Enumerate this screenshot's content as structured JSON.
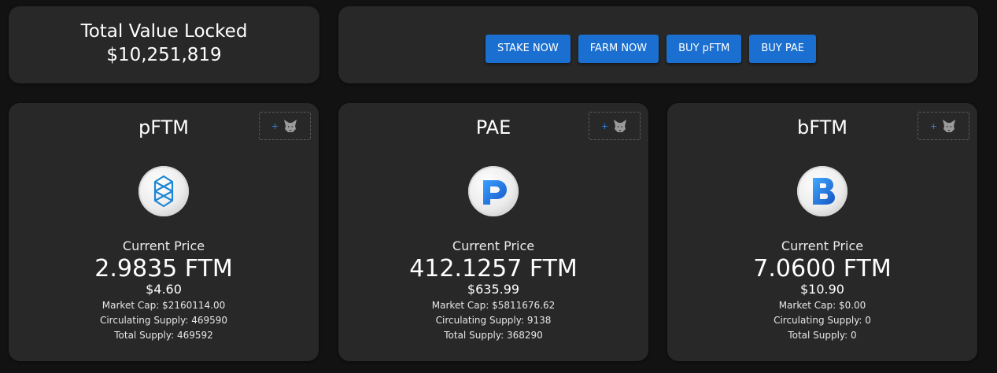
{
  "tvl": {
    "title": "Total Value Locked",
    "value": "$10,251,819"
  },
  "actions": {
    "stake_label": "STAKE NOW",
    "farm_label": "FARM NOW",
    "buy_pftm_label": "BUY pFTM",
    "buy_pae_label": "BUY PAE"
  },
  "tokens": [
    {
      "name": "pFTM",
      "icon": "fantom-icon",
      "price_label": "Current Price",
      "price_ftm": "2.9835 FTM",
      "price_usd": "$4.60",
      "market_cap": "Market Cap: $2160114.00",
      "circulating_supply": "Circulating Supply: 469590",
      "total_supply": "Total Supply: 469592"
    },
    {
      "name": "PAE",
      "icon": "pae-icon",
      "price_label": "Current Price",
      "price_ftm": "412.1257 FTM",
      "price_usd": "$635.99",
      "market_cap": "Market Cap: $5811676.62",
      "circulating_supply": "Circulating Supply: 9138",
      "total_supply": "Total Supply: 368290"
    },
    {
      "name": "bFTM",
      "icon": "bftm-icon",
      "price_label": "Current Price",
      "price_ftm": "7.0600 FTM",
      "price_usd": "$10.90",
      "market_cap": "Market Cap: $0.00",
      "circulating_supply": "Circulating Supply: 0",
      "total_supply": "Total Supply: 0"
    }
  ],
  "add_to_wallet_icons": [
    "plus-icon",
    "metamask-fox-icon"
  ],
  "colors": {
    "background": "#121212",
    "card": "#282828",
    "button": "#1a6fd0",
    "accent": "#2f86e6"
  }
}
